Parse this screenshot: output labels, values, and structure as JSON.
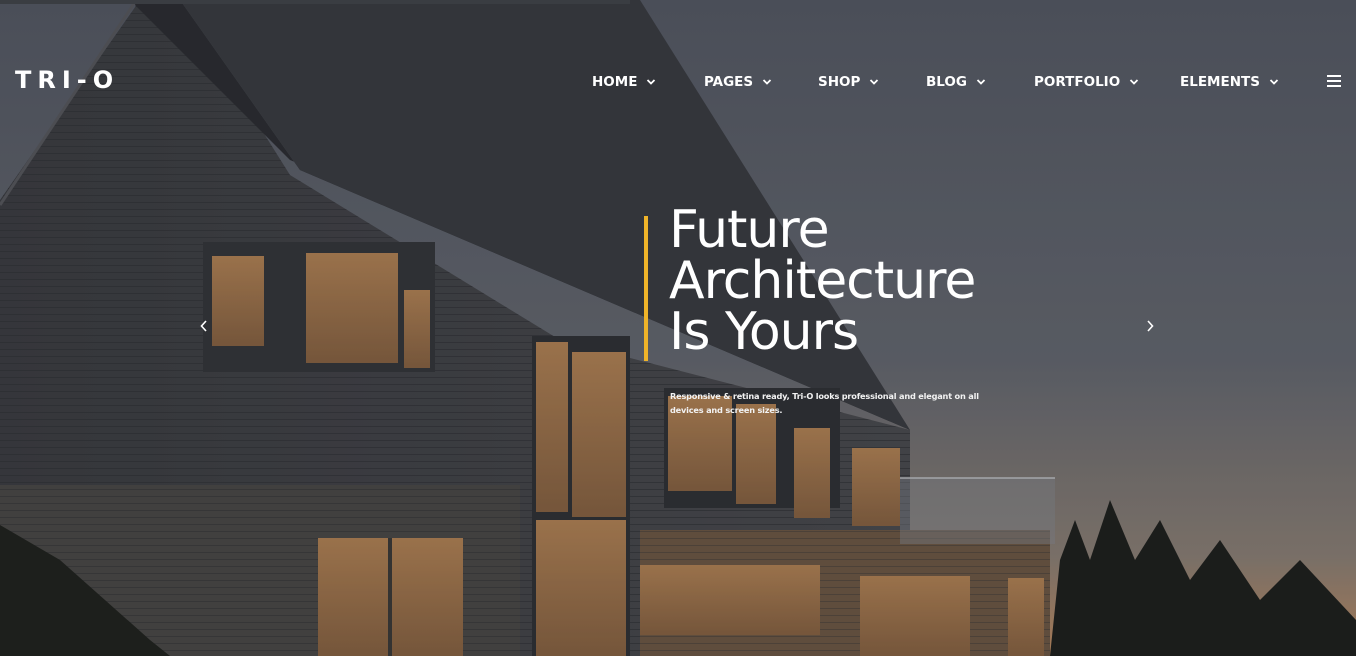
{
  "brand": {
    "logo_text": "TRI-O"
  },
  "nav": {
    "items": [
      {
        "label": "HOME",
        "icon": "chevron-down-icon"
      },
      {
        "label": "PAGES",
        "icon": "chevron-down-icon"
      },
      {
        "label": "SHOP",
        "icon": "chevron-down-icon"
      },
      {
        "label": "BLOG",
        "icon": "chevron-down-icon"
      },
      {
        "label": "PORTFOLIO",
        "icon": "chevron-down-icon"
      },
      {
        "label": "ELEMENTS",
        "icon": "chevron-down-icon"
      }
    ],
    "menu_icon": "hamburger-menu-icon"
  },
  "hero": {
    "title_lines": [
      "Future",
      "Architecture",
      "Is Yours"
    ],
    "description": "Responsive & retina ready, Tri-O looks professional and elegant on all devices and screen sizes.",
    "accent_color": "#f0b429"
  },
  "slider": {
    "prev_icon": "chevron-left-icon",
    "next_icon": "chevron-right-icon"
  }
}
